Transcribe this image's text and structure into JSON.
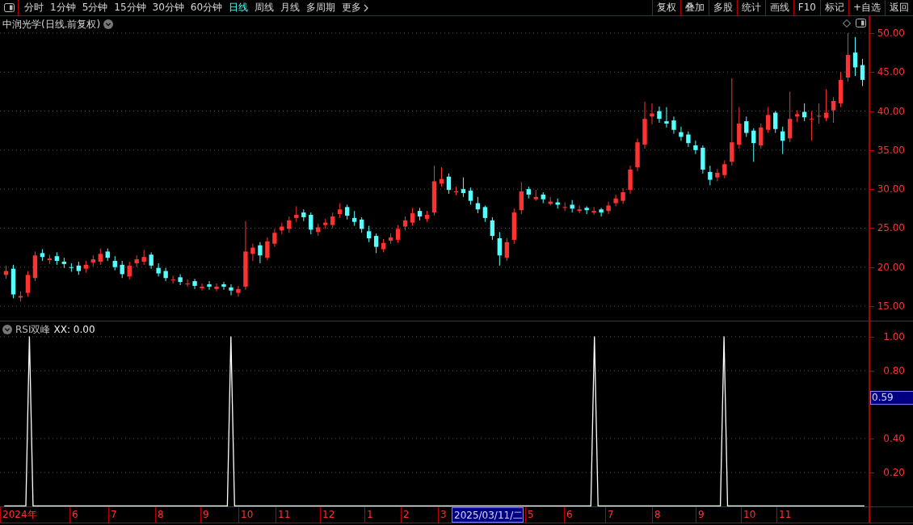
{
  "toolbar": {
    "periods": [
      {
        "label": "分时",
        "selected": false
      },
      {
        "label": "1分钟",
        "selected": false
      },
      {
        "label": "5分钟",
        "selected": false
      },
      {
        "label": "15分钟",
        "selected": false
      },
      {
        "label": "30分钟",
        "selected": false
      },
      {
        "label": "60分钟",
        "selected": false
      },
      {
        "label": "日线",
        "selected": true
      },
      {
        "label": "周线",
        "selected": false
      },
      {
        "label": "月线",
        "selected": false
      },
      {
        "label": "多周期",
        "selected": false
      }
    ],
    "more": "更多",
    "actions": [
      "复权",
      "叠加",
      "多股",
      "统计",
      "画线",
      "F10",
      "标记",
      "+自选",
      "返回"
    ]
  },
  "price_chart": {
    "title": "中润光学(日线.前复权)",
    "chart_data": {
      "type": "candlestick",
      "categories": [
        null,
        null,
        null,
        null,
        null,
        null,
        null,
        null,
        null,
        null,
        null,
        null,
        null,
        null,
        null,
        null,
        null,
        null,
        null,
        null,
        null,
        null,
        null,
        null,
        null,
        null,
        null,
        null,
        null,
        null,
        null,
        null,
        null,
        null,
        null,
        null,
        null,
        null,
        null,
        null,
        null,
        null,
        null,
        null,
        null,
        null,
        null,
        null,
        null,
        null,
        null,
        null,
        null,
        null,
        null,
        null,
        null,
        null,
        null,
        null,
        null,
        null,
        null,
        null,
        null,
        null,
        null,
        null,
        null,
        null,
        null,
        null,
        null,
        null,
        null,
        null,
        null,
        null,
        null,
        null,
        null,
        null,
        null,
        null,
        null,
        null,
        null,
        null,
        null,
        null,
        null,
        null,
        null,
        null,
        null,
        null,
        null,
        null,
        null,
        null,
        null,
        null,
        null,
        null,
        null,
        null,
        null,
        null,
        null,
        null,
        null,
        null,
        null,
        null,
        null,
        null,
        null,
        null,
        null
      ],
      "ohlc": [
        [
          19.0,
          20.2,
          18.5,
          19.5
        ],
        [
          19.8,
          20.3,
          16.0,
          16.5
        ],
        [
          16.1,
          16.9,
          15.6,
          16.3
        ],
        [
          16.7,
          19.5,
          16.2,
          19.0
        ],
        [
          18.6,
          22.0,
          18.2,
          21.5
        ],
        [
          21.8,
          22.3,
          20.8,
          21.3
        ],
        [
          20.9,
          21.6,
          20.4,
          21.1
        ],
        [
          21.4,
          21.9,
          20.3,
          20.8
        ],
        [
          20.7,
          21.2,
          19.9,
          20.4
        ],
        [
          20.0,
          20.5,
          19.4,
          19.9
        ],
        [
          20.2,
          20.7,
          19.0,
          19.5
        ],
        [
          19.8,
          20.8,
          19.3,
          20.3
        ],
        [
          20.6,
          21.5,
          20.1,
          21.0
        ],
        [
          20.7,
          22.4,
          20.3,
          21.7
        ],
        [
          22.0,
          22.4,
          20.8,
          21.2
        ],
        [
          20.8,
          21.4,
          19.6,
          20.0
        ],
        [
          20.3,
          20.8,
          18.6,
          19.1
        ],
        [
          18.8,
          20.7,
          18.4,
          20.2
        ],
        [
          20.5,
          21.5,
          20.0,
          21.0
        ],
        [
          20.7,
          22.2,
          20.3,
          21.3
        ],
        [
          21.6,
          21.9,
          19.8,
          20.2
        ],
        [
          19.9,
          20.5,
          18.8,
          19.2
        ],
        [
          19.5,
          19.9,
          18.2,
          18.6
        ],
        [
          18.3,
          18.9,
          17.9,
          18.4
        ],
        [
          18.7,
          19.1,
          17.7,
          18.1
        ],
        [
          17.8,
          18.4,
          17.5,
          17.9
        ],
        [
          18.2,
          18.5,
          17.2,
          17.6
        ],
        [
          17.3,
          17.9,
          17.0,
          17.5
        ],
        [
          17.8,
          18.2,
          17.1,
          17.5
        ],
        [
          17.2,
          17.9,
          16.9,
          17.5
        ],
        [
          17.8,
          18.1,
          17.1,
          17.5
        ],
        [
          17.4,
          17.8,
          16.4,
          17.0
        ],
        [
          16.7,
          17.6,
          16.2,
          17.2
        ],
        [
          17.5,
          25.9,
          17.1,
          22.0
        ],
        [
          21.7,
          23.0,
          20.8,
          22.5
        ],
        [
          22.8,
          23.2,
          20.5,
          21.5
        ],
        [
          21.2,
          23.8,
          20.9,
          23.3
        ],
        [
          23.0,
          24.9,
          22.6,
          24.4
        ],
        [
          24.7,
          25.7,
          24.2,
          25.2
        ],
        [
          24.9,
          26.5,
          24.4,
          26.0
        ],
        [
          26.3,
          27.8,
          25.8,
          26.7
        ],
        [
          27.0,
          27.4,
          25.9,
          26.4
        ],
        [
          26.7,
          27.0,
          24.2,
          24.8
        ],
        [
          24.5,
          25.6,
          24.0,
          25.1
        ],
        [
          25.4,
          26.2,
          24.9,
          25.7
        ],
        [
          25.4,
          27.0,
          25.0,
          26.5
        ],
        [
          26.8,
          28.2,
          26.3,
          27.4
        ],
        [
          27.7,
          28.0,
          26.1,
          26.6
        ],
        [
          26.3,
          27.2,
          25.3,
          25.8
        ],
        [
          26.1,
          26.4,
          24.4,
          24.9
        ],
        [
          24.6,
          25.3,
          23.2,
          23.7
        ],
        [
          24.0,
          24.3,
          21.8,
          22.6
        ],
        [
          22.3,
          23.6,
          21.9,
          23.1
        ],
        [
          23.4,
          24.3,
          23.0,
          23.8
        ],
        [
          23.5,
          25.4,
          23.1,
          24.9
        ],
        [
          25.2,
          26.5,
          24.7,
          26.0
        ],
        [
          25.7,
          27.6,
          25.3,
          26.9
        ],
        [
          27.2,
          27.6,
          26.0,
          26.5
        ],
        [
          26.2,
          27.2,
          25.8,
          26.7
        ],
        [
          27.0,
          33.0,
          26.6,
          31.0
        ],
        [
          30.7,
          32.8,
          30.3,
          31.3
        ],
        [
          31.6,
          32.0,
          29.4,
          29.9
        ],
        [
          29.6,
          30.3,
          29.2,
          29.7
        ],
        [
          30.0,
          31.5,
          29.0,
          29.5
        ],
        [
          29.8,
          30.2,
          28.0,
          28.5
        ],
        [
          28.2,
          29.0,
          26.9,
          27.4
        ],
        [
          27.7,
          27.9,
          25.8,
          26.3
        ],
        [
          26.0,
          26.4,
          23.5,
          24.0
        ],
        [
          23.7,
          24.5,
          20.2,
          21.5
        ],
        [
          21.2,
          23.7,
          20.8,
          23.2
        ],
        [
          23.5,
          27.5,
          23.0,
          27.0
        ],
        [
          27.3,
          30.9,
          26.8,
          29.7
        ],
        [
          30.0,
          30.3,
          28.8,
          29.3
        ],
        [
          28.7,
          29.9,
          28.5,
          29.0
        ],
        [
          29.3,
          29.6,
          28.2,
          28.7
        ],
        [
          28.1,
          29.0,
          27.9,
          28.4
        ],
        [
          28.3,
          28.8,
          27.5,
          28.0
        ],
        [
          27.6,
          28.3,
          27.2,
          27.7
        ],
        [
          28.0,
          28.6,
          27.0,
          27.5
        ],
        [
          27.2,
          27.9,
          26.9,
          27.4
        ],
        [
          27.6,
          27.8,
          26.8,
          27.3
        ],
        [
          27.0,
          27.7,
          26.7,
          27.2
        ],
        [
          27.4,
          27.6,
          26.5,
          27.0
        ],
        [
          27.2,
          28.4,
          26.8,
          27.9
        ],
        [
          28.2,
          29.3,
          27.8,
          28.8
        ],
        [
          28.5,
          30.1,
          28.1,
          29.6
        ],
        [
          29.9,
          33.0,
          29.4,
          32.5
        ],
        [
          32.8,
          36.5,
          32.3,
          36.0
        ],
        [
          35.7,
          41.2,
          35.2,
          39.0
        ],
        [
          39.3,
          41.0,
          38.3,
          39.7
        ],
        [
          40.0,
          40.6,
          38.5,
          39.0
        ],
        [
          38.7,
          40.5,
          37.9,
          38.4
        ],
        [
          38.8,
          39.3,
          37.1,
          37.6
        ],
        [
          37.3,
          38.0,
          36.2,
          36.7
        ],
        [
          37.0,
          37.4,
          35.4,
          35.9
        ],
        [
          35.6,
          36.2,
          34.5,
          35.0
        ],
        [
          35.3,
          35.6,
          32.0,
          32.5
        ],
        [
          32.2,
          33.0,
          30.5,
          31.2
        ],
        [
          31.5,
          32.6,
          31.0,
          32.1
        ],
        [
          31.8,
          33.7,
          31.4,
          33.2
        ],
        [
          33.5,
          44.2,
          33.0,
          36.0
        ],
        [
          35.7,
          40.5,
          35.2,
          38.4
        ],
        [
          38.7,
          39.3,
          36.7,
          37.2
        ],
        [
          37.5,
          37.8,
          33.5,
          35.9
        ],
        [
          35.6,
          38.4,
          35.2,
          37.9
        ],
        [
          37.6,
          40.5,
          37.2,
          39.5
        ],
        [
          39.8,
          40.0,
          37.2,
          37.7
        ],
        [
          37.4,
          38.0,
          34.5,
          36.2
        ],
        [
          36.5,
          42.5,
          36.0,
          39.0
        ],
        [
          39.3,
          40.1,
          38.6,
          39.6
        ],
        [
          39.9,
          41.0,
          38.7,
          39.2
        ],
        [
          38.9,
          40.0,
          36.2,
          39.0
        ],
        [
          39.3,
          41.0,
          38.4,
          39.4
        ],
        [
          39.1,
          42.8,
          38.7,
          39.8
        ],
        [
          40.1,
          41.8,
          38.5,
          41.3
        ],
        [
          41.0,
          45.0,
          40.5,
          44.0
        ],
        [
          44.3,
          50.0,
          43.8,
          47.2
        ],
        [
          47.5,
          49.5,
          44.5,
          45.6
        ],
        [
          45.9,
          46.7,
          43.2,
          44.0
        ]
      ],
      "ylim": [
        13.14,
        52.17
      ],
      "grid": true,
      "yticks": [
        {
          "value": 50,
          "label": "50.00"
        },
        {
          "value": 45,
          "label": "45.00"
        },
        {
          "value": 40,
          "label": "40.00"
        },
        {
          "value": 35,
          "label": "35.00"
        },
        {
          "value": 30,
          "label": "30.00"
        },
        {
          "value": 25,
          "label": "25.00"
        },
        {
          "value": 20,
          "label": "20.00"
        },
        {
          "value": 15,
          "label": "15.00"
        }
      ]
    }
  },
  "indicator": {
    "name": "RSI双峰",
    "value_label": ": 0.00",
    "cursor_value": "0.59",
    "chart_data": {
      "type": "line",
      "categories": [
        null,
        null,
        null,
        null,
        null,
        null,
        null,
        null,
        null,
        null,
        null,
        null,
        null,
        null,
        null,
        null,
        null,
        null,
        null,
        null,
        null,
        null,
        null,
        null,
        null,
        null,
        null,
        null,
        null,
        null,
        null,
        null,
        null,
        null,
        null,
        null,
        null,
        null,
        null,
        null,
        null,
        null,
        null,
        null,
        null,
        null,
        null,
        null,
        null,
        null,
        null,
        null,
        null,
        null,
        null,
        null,
        null,
        null,
        null,
        null,
        null,
        null,
        null,
        null,
        null,
        null,
        null,
        null,
        null,
        null,
        null,
        null,
        null,
        null,
        null,
        null,
        null,
        null,
        null,
        null,
        null,
        null,
        null,
        null,
        null,
        null,
        null,
        null,
        null,
        null,
        null,
        null,
        null,
        null,
        null,
        null,
        null,
        null,
        null,
        null,
        null,
        null,
        null,
        null,
        null,
        null,
        null,
        null,
        null,
        null,
        null,
        null,
        null,
        null,
        null,
        null,
        null,
        null,
        null,
        null,
        null,
        null,
        null,
        null,
        null,
        null,
        null,
        null,
        null,
        null,
        null,
        null,
        null,
        null,
        null,
        null,
        null,
        null,
        null,
        null,
        null,
        null,
        null,
        null,
        null,
        null,
        null,
        null,
        null,
        null,
        null,
        null,
        null,
        null,
        null,
        null,
        null,
        null,
        null,
        null,
        null,
        null,
        null,
        null,
        null,
        null,
        null,
        null,
        null,
        null,
        null,
        null,
        null,
        null,
        null,
        null,
        null,
        null,
        null,
        null,
        null,
        null,
        null,
        null,
        null,
        null,
        null,
        null,
        null,
        null,
        null,
        null,
        null,
        null,
        null,
        null,
        null,
        null,
        null,
        null,
        null,
        null,
        null,
        null,
        null,
        null,
        null,
        null,
        null,
        null,
        null,
        null,
        null,
        null,
        null,
        null,
        null,
        null,
        null,
        null,
        null,
        null,
        null,
        null,
        null,
        null,
        null,
        null,
        null,
        null,
        null,
        null,
        null,
        null,
        null,
        null,
        null,
        null,
        null,
        null
      ],
      "series": [
        {
          "name": "XX",
          "color": "#ffffff",
          "values": [
            0,
            0,
            0,
            0,
            0,
            0,
            0,
            1,
            0,
            0,
            0,
            0,
            0,
            0,
            0,
            0,
            0,
            0,
            0,
            0,
            0,
            0,
            0,
            0,
            0,
            0,
            0,
            0,
            0,
            0,
            0,
            0,
            0,
            0,
            0,
            0,
            0,
            0,
            0,
            0,
            0,
            0,
            0,
            0,
            0,
            0,
            0,
            0,
            0,
            0,
            0,
            0,
            0,
            0,
            0,
            0,
            0,
            0,
            0,
            0,
            0,
            0,
            0,
            1,
            0,
            0,
            0,
            0,
            0,
            0,
            0,
            0,
            0,
            0,
            0,
            0,
            0,
            0,
            0,
            0,
            0,
            0,
            0,
            0,
            0,
            0,
            0,
            0,
            0,
            0,
            0,
            0,
            0,
            0,
            0,
            0,
            0,
            0,
            0,
            0,
            0,
            0,
            0,
            0,
            0,
            0,
            0,
            0,
            0,
            0,
            0,
            0,
            0,
            0,
            0,
            0,
            0,
            0,
            0,
            0,
            0,
            0,
            0,
            0,
            0,
            0,
            0,
            0,
            0,
            0,
            0,
            0,
            0,
            0,
            0,
            0,
            0,
            0,
            0,
            0,
            0,
            0,
            0,
            0,
            0,
            0,
            0,
            0,
            0,
            0,
            0,
            0,
            0,
            0,
            0,
            0,
            0,
            0,
            0,
            0,
            0,
            0,
            0,
            0,
            1,
            0,
            0,
            0,
            0,
            0,
            0,
            0,
            0,
            0,
            0,
            0,
            0,
            0,
            0,
            0,
            0,
            0,
            0,
            0,
            0,
            0,
            0,
            0,
            0,
            0,
            0,
            0,
            0,
            0,
            0,
            0,
            0,
            0,
            0,
            0,
            1,
            0,
            0,
            0,
            0,
            0,
            0,
            0,
            0,
            0,
            0,
            0,
            0,
            0,
            0,
            0,
            0,
            0,
            0,
            0,
            0,
            0,
            0,
            0,
            0,
            0,
            0,
            0,
            0,
            0,
            0,
            0,
            0,
            0,
            0,
            0,
            0,
            0,
            0,
            0
          ]
        }
      ],
      "ylim": [
        0,
        1.09
      ],
      "grid": true,
      "yticks": [
        {
          "value": 0.2,
          "label": "0.20"
        },
        {
          "value": 0.4,
          "label": "0.40"
        },
        {
          "value": 0.8,
          "label": "0.80"
        },
        {
          "value": 1,
          "label": "1.00"
        }
      ]
    }
  },
  "time_axis": {
    "labels": [
      {
        "label": "2024年",
        "selected": false
      },
      {
        "label": "6",
        "selected": false
      },
      {
        "label": "7",
        "selected": false
      },
      {
        "label": "8",
        "selected": false
      },
      {
        "label": "9",
        "selected": false
      },
      {
        "label": "10",
        "selected": false
      },
      {
        "label": "11",
        "selected": false
      },
      {
        "label": "12",
        "selected": false
      },
      {
        "label": "1",
        "selected": false
      },
      {
        "label": "2",
        "selected": false
      },
      {
        "label": "3",
        "selected": false
      },
      {
        "label": "2025/03/11/二",
        "selected": true
      },
      {
        "label": "5",
        "selected": false
      },
      {
        "label": "6",
        "selected": false
      },
      {
        "label": "7",
        "selected": false
      },
      {
        "label": "8",
        "selected": false
      },
      {
        "label": "9",
        "selected": false
      },
      {
        "label": "10",
        "selected": false
      },
      {
        "label": "11",
        "selected": false
      }
    ]
  }
}
